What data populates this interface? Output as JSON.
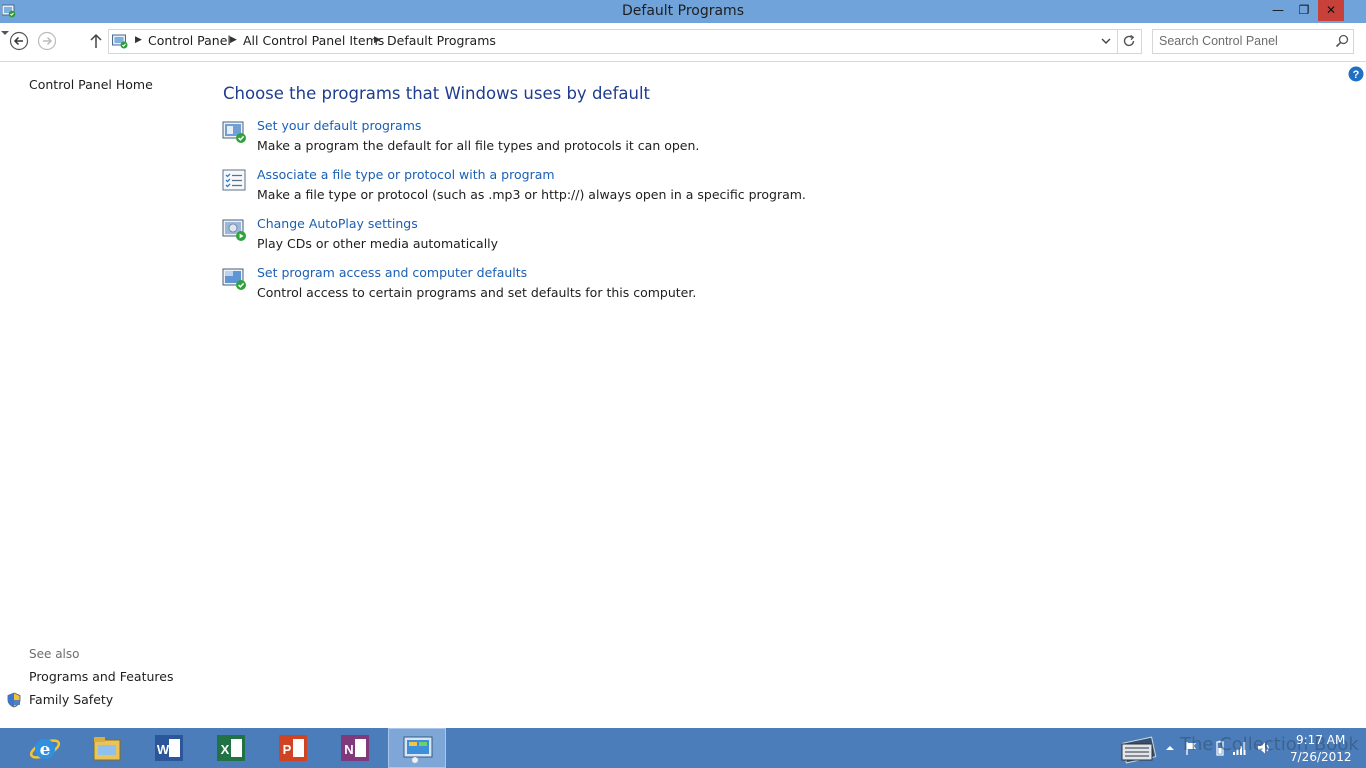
{
  "window": {
    "title": "Default Programs",
    "minimize_label": "—",
    "restore_label": "❐",
    "close_label": "✕"
  },
  "nav": {
    "breadcrumbs": [
      "Control Panel",
      "All Control Panel Items",
      "Default Programs"
    ],
    "search_placeholder": "Search Control Panel"
  },
  "left_pane": {
    "home_link": "Control Panel Home",
    "see_also_label": "See also",
    "see_also_links": [
      "Programs and Features",
      "Family Safety"
    ]
  },
  "main": {
    "heading": "Choose the programs that Windows uses by default",
    "tasks": [
      {
        "title": "Set your default programs",
        "description": "Make a program the default for all file types and protocols it can open.",
        "icon": "default-programs-icon"
      },
      {
        "title": "Associate a file type or protocol with a program",
        "description": "Make a file type or protocol (such as .mp3 or http://) always open in a specific program.",
        "icon": "file-association-icon"
      },
      {
        "title": "Change AutoPlay settings",
        "description": "Play CDs or other media automatically",
        "icon": "autoplay-icon"
      },
      {
        "title": "Set program access and computer defaults",
        "description": "Control access to certain programs and set defaults for this computer.",
        "icon": "program-access-icon"
      }
    ]
  },
  "taskbar": {
    "apps": [
      "internet-explorer-icon",
      "file-explorer-icon",
      "word-icon",
      "excel-icon",
      "powerpoint-icon",
      "onenote-icon",
      "control-panel-icon"
    ],
    "watermark": "The Collection Book",
    "time": "9:17 AM",
    "date": "7/26/2012"
  },
  "colors": {
    "title_bar": "#6fa3d9",
    "close_button": "#c7413a",
    "heading": "#1e3d8f",
    "link": "#1a5fb4",
    "taskbar": "#4c7dbb"
  }
}
